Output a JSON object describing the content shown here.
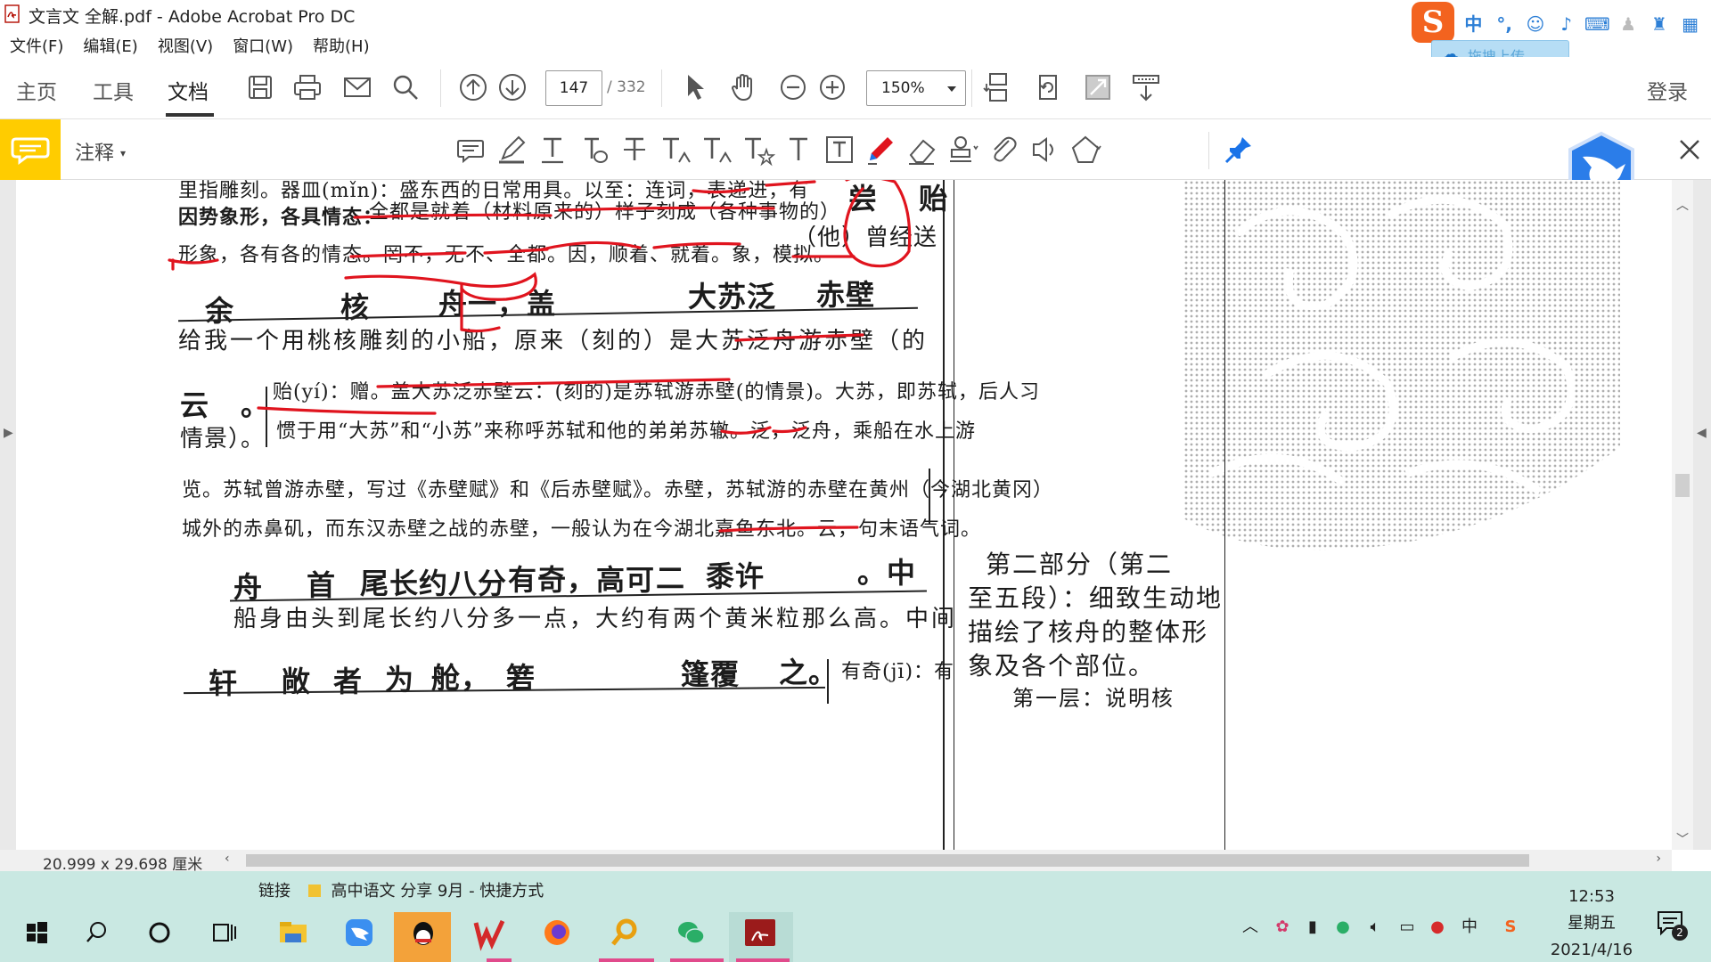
{
  "window": {
    "title": "文言文 全解.pdf - Adobe Acrobat Pro DC"
  },
  "menu": [
    "文件(F)",
    "编辑(E)",
    "视图(V)",
    "窗口(W)",
    "帮助(H)"
  ],
  "ime": {
    "lang": "中",
    "upload_label": "拖拽上传"
  },
  "toolbar": {
    "tabs": [
      "主页",
      "工具",
      "文档"
    ],
    "active_tab": "文档",
    "page_current": "147",
    "page_total": "/ 332",
    "zoom": "150%",
    "login": "登录",
    "icons": [
      "save-icon",
      "print-icon",
      "email-icon",
      "search-icon",
      "prev-page-icon",
      "next-page-icon",
      "select-cursor-icon",
      "hand-icon",
      "zoom-out-icon",
      "zoom-in-icon",
      "page-display-icon",
      "rotate-icon",
      "fullscreen-icon",
      "read-mode-icon"
    ]
  },
  "commentbar": {
    "label": "注释",
    "tools": [
      "sticky-note-icon",
      "highlight-icon",
      "underline-text-icon",
      "strikethrough-text-icon",
      "replace-text-icon",
      "insert-text-icon",
      "add-note-text-icon",
      "text-comment-icon",
      "add-text-icon",
      "text-box-icon",
      "pencil-icon",
      "eraser-icon",
      "stamp-icon",
      "attach-icon",
      "record-audio-icon",
      "shapes-icon"
    ]
  },
  "document": {
    "lines": {
      "l0": "里指雕刻。器皿(mǐn)：盛东西的日常用具。以至：连词，表递进，有",
      "l1_bold": "因势象形，各具情态：",
      "l1": "全都是就着（材料原来的）样子刻成（各种事物的）",
      "l2": "形象，各有各的情态。罔不，无不、全都。因，顺着、就着。象，模拟。",
      "l2b": "（他）曾经送",
      "l2c": "尝  贻",
      "l3_a": "余",
      "l3_b": "核",
      "l3_c": "舟一，盖",
      "l3_d": "大苏泛",
      "l3_e": "赤壁",
      "l4": "给我一个用桃核雕刻的小船，原来（刻的）是大苏泛舟游赤壁（的",
      "l5_a": "云",
      "l5_b": "。",
      "l5_note": "贻(yí)：赠。盖大苏泛赤壁云：(刻的)是苏轼游赤壁(的情景)。大苏，即苏轼，后人习",
      "l6_a": "情景）。",
      "l6_note": "惯于用“大苏”和“小苏”来称呼苏轼和他的弟弟苏辙。泛，泛舟，乘船在水上游",
      "l7": "览。苏轼曾游赤壁，写过《赤壁赋》和《后赤壁赋》。赤壁，苏轼游的赤壁在黄州（今湖北黄冈）",
      "l8": "城外的赤鼻矶，而东汉赤壁之战的赤壁，一般认为在今湖北嘉鱼东北。云，句末语气词。",
      "l9_a": "舟",
      "l9_b": "首",
      "l9_c": "尾长约八分",
      "l9_d": "有奇，高可",
      "l9_e": "二",
      "l9_f": "黍许",
      "l9_g": "。中",
      "l10": "船身由头到尾长约八分多一点，大约有两个黄米粒那么高。中间",
      "l11_a": "轩",
      "l11_b": "敞",
      "l11_c": "者",
      "l11_d": "为",
      "l11_e": "舱，",
      "l11_f": "箬",
      "l11_g": "篷覆",
      "l11_h": "之。",
      "l11_note": "有奇(jī)：有"
    },
    "side_note": [
      "第二部分（第二",
      "至五段）：细致生动地",
      "描绘了核舟的整体形",
      "象及各个部位。",
      "第一层：说明核"
    ]
  },
  "statusbar": {
    "dimensions": "20.999 x 29.698 厘米"
  },
  "taskbar": {
    "shortcut_label": "链接",
    "shortcut_item": "高中语文 分享 9月 - 快捷方式",
    "time": "12:53",
    "weekday": "星期五",
    "date": "2021/4/16",
    "notification_count": "2",
    "tray_lang": "中",
    "apps": [
      "start-icon",
      "search-icon",
      "cortana-icon",
      "task-view-icon",
      "file-explorer-icon",
      "dingtalk-icon",
      "qq-icon",
      "wps-icon",
      "firefox-icon",
      "search-tool-icon",
      "wechat-icon",
      "acrobat-icon"
    ]
  },
  "colors": {
    "comment_accent": "#ffcc00",
    "annotation_red": "#e0141e",
    "taskbar_bg": "#c9e8e2",
    "ime_orange": "#f3631f"
  }
}
